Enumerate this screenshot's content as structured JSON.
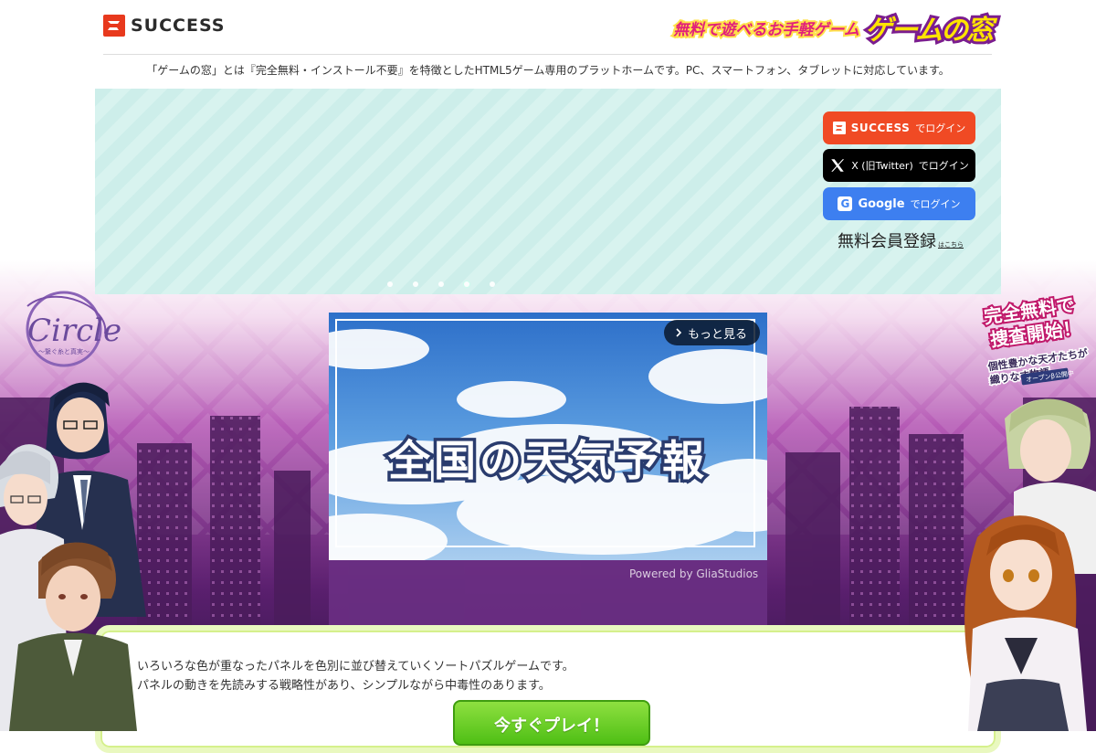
{
  "header": {
    "logo_text": "SUCCESS",
    "brand_tagline": "無料で遊べるお手軽ゲーム",
    "brand_name": "ゲームの窓"
  },
  "tagline": "「ゲームの窓」とは『完全無料・インストール不要』を特徴としたHTML5ゲーム専用のプラットホームです。PC、スマートフォン、タブレットに対応しています。",
  "login": {
    "success": {
      "brand": "SUCCESS",
      "suffix": "でログイン"
    },
    "x": {
      "brand": "X (旧Twitter)",
      "suffix": "でログイン"
    },
    "google": {
      "brand": "Google",
      "suffix": "でログイン"
    },
    "register": {
      "label": "無料会員登録",
      "note": "はこちら"
    }
  },
  "carousel": {
    "slides": 5,
    "active_index": 3
  },
  "video": {
    "more_label": "もっと見る",
    "title": "全国の天気予報",
    "powered_by": "Powered by GliaStudios"
  },
  "description": {
    "line1": "いろいろな色が重なったパネルを色別に並び替えていくソートパズルゲームです。",
    "line2": "パネルの動きを先読みする戦略性があり、シンプルながら中毒性のあります。",
    "play_label": "今すぐプレイ！"
  },
  "ads": {
    "left": {
      "title": "Circle",
      "subtitle": "～繋ぐ糸と真実～"
    },
    "right": {
      "headline_1": "完全無料で",
      "headline_2": "捜査開始！",
      "copy_1": "個性豊かな天才たちが",
      "copy_2": "織りなす物語",
      "badge": "オープンβ公開中"
    }
  },
  "colors": {
    "success_red": "#f04a24",
    "x_black": "#000000",
    "google_blue": "#3d7ff0",
    "play_green": "#4fbf15",
    "hero_mint": "#cdeeea"
  },
  "icons": [
    "success-logo-icon",
    "x-logo-icon",
    "google-g-icon",
    "chevron-right-icon"
  ]
}
